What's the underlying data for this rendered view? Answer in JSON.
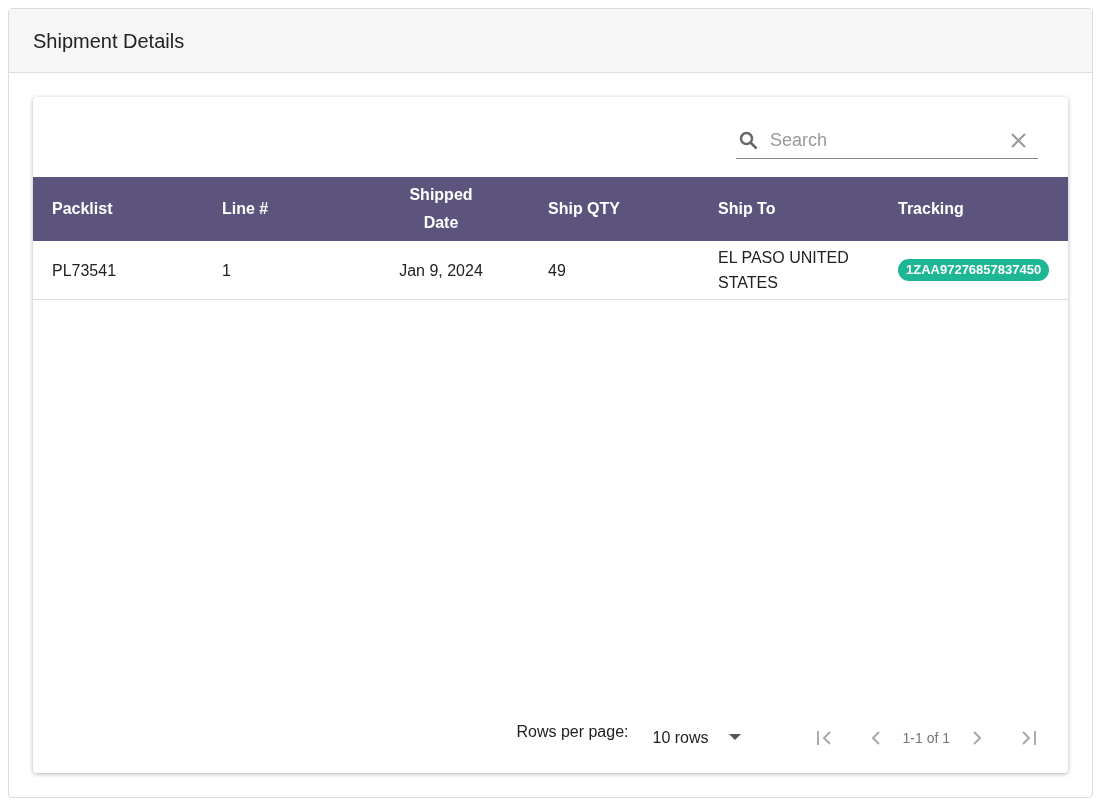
{
  "panel": {
    "title": "Shipment Details"
  },
  "search": {
    "placeholder": "Search"
  },
  "table": {
    "columns": [
      {
        "label": "Packlist"
      },
      {
        "label": "Line #"
      },
      {
        "label": "Shipped Date"
      },
      {
        "label": "Ship QTY"
      },
      {
        "label": "Ship To"
      },
      {
        "label": "Tracking"
      }
    ],
    "rows": [
      {
        "cells": [
          {
            "kind": "text",
            "text": "PL73541"
          },
          {
            "kind": "text",
            "text": "1"
          },
          {
            "kind": "text",
            "text": "Jan 9, 2024"
          },
          {
            "kind": "text",
            "text": "49"
          },
          {
            "kind": "text",
            "text": "EL PASO UNITED STATES"
          },
          {
            "kind": "badge",
            "text": "1ZAA97276857837450"
          }
        ]
      }
    ]
  },
  "pagination": {
    "rows_label": "Rows per page:",
    "rows_value": "10 rows",
    "range": "1-1 of 1",
    "buttons": [
      {
        "kind": "first",
        "disabled": true
      },
      {
        "kind": "prev",
        "disabled": true
      },
      {
        "kind": "range"
      },
      {
        "kind": "next",
        "disabled": true
      },
      {
        "kind": "last",
        "disabled": true
      }
    ]
  }
}
